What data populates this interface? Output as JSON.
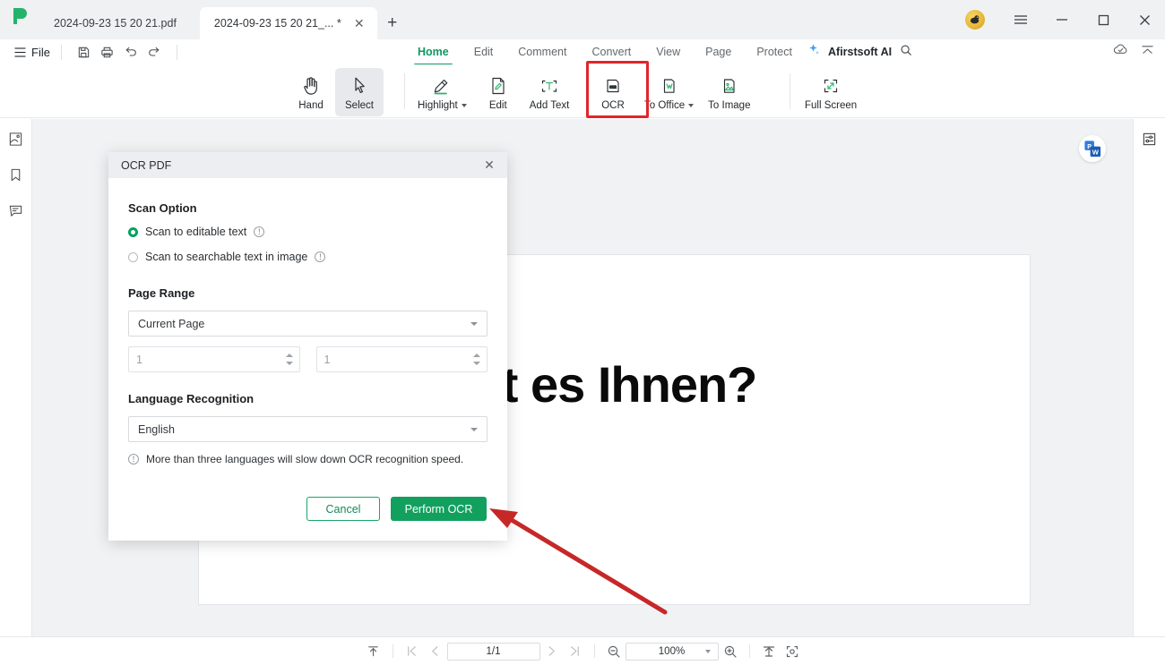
{
  "window": {
    "tabs": [
      {
        "title": "2024-09-23 15 20 21.pdf",
        "active": false
      },
      {
        "title": "2024-09-23 15 20 21_... *",
        "active": true
      }
    ],
    "new_tab_label": "+",
    "close_label": "✕",
    "controls": {
      "menu": "☰",
      "minimize": "—",
      "maximize": "□",
      "close": "✕"
    }
  },
  "menu": {
    "file_label": "File",
    "quick_icons": [
      "save-as-icon",
      "print-icon",
      "undo-icon",
      "redo-icon"
    ]
  },
  "ribbon_tabs": [
    {
      "label": "Home",
      "selected": true
    },
    {
      "label": "Edit",
      "selected": false
    },
    {
      "label": "Comment",
      "selected": false
    },
    {
      "label": "Convert",
      "selected": false
    },
    {
      "label": "View",
      "selected": false
    },
    {
      "label": "Page",
      "selected": false
    },
    {
      "label": "Protect",
      "selected": false
    }
  ],
  "ai": {
    "label": "Afirstsoft AI",
    "search_icon": "search-icon"
  },
  "ribbon_items": {
    "hand": "Hand",
    "select": "Select",
    "highlight": "Highlight",
    "edit": "Edit",
    "add_text": "Add Text",
    "ocr": "OCR",
    "to_office": "To Office",
    "to_image": "To Image",
    "full_screen": "Full Screen"
  },
  "document": {
    "visible_text": "ht es Ihnen?"
  },
  "dialog": {
    "title": "OCR PDF",
    "close_label": "✕",
    "scan_option": {
      "heading": "Scan Option",
      "options": [
        {
          "label": "Scan to editable text",
          "selected": true
        },
        {
          "label": "Scan to searchable text in image",
          "selected": false
        }
      ]
    },
    "page_range": {
      "heading": "Page Range",
      "selected": "Current Page",
      "from_value": "1",
      "to_value": "1"
    },
    "language": {
      "heading": "Language Recognition",
      "selected": "English",
      "note": "More than three languages will slow down OCR recognition speed."
    },
    "buttons": {
      "cancel": "Cancel",
      "perform": "Perform OCR"
    }
  },
  "statusbar": {
    "page_indicator": "1/1",
    "zoom_level": "100%"
  },
  "colors": {
    "accent_green": "#12a05f",
    "highlight_red": "#e0262c",
    "arrow_red": "#c62828",
    "titlebar_bg": "#f0f1f3",
    "canvas_bg": "#f1f2f4"
  }
}
